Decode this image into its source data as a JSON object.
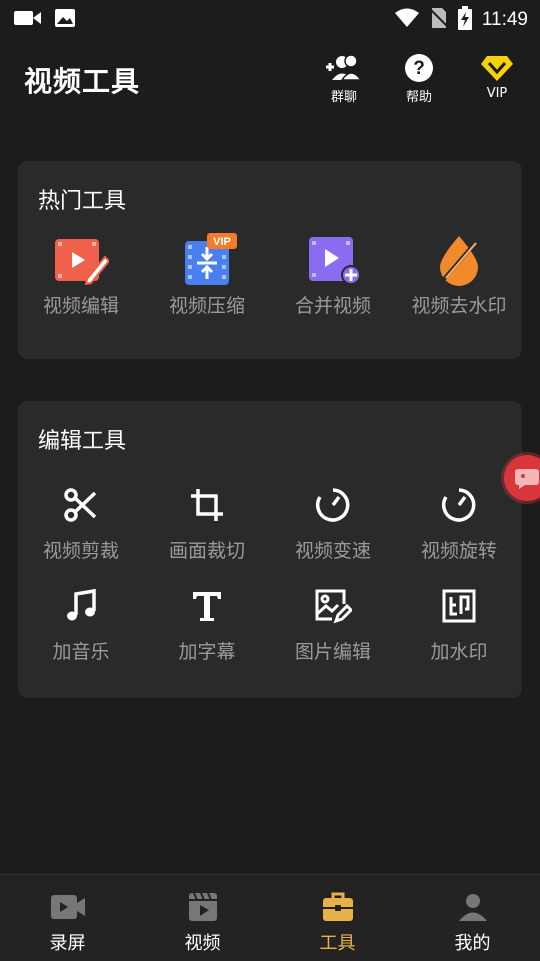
{
  "status_bar": {
    "time": "11:49"
  },
  "header": {
    "title": "视频工具",
    "buttons": [
      {
        "label": "群聊",
        "icon": "add-group-icon"
      },
      {
        "label": "帮助",
        "icon": "help-icon"
      },
      {
        "label": "VIP",
        "icon": "vip-diamond-icon"
      }
    ]
  },
  "hot_tools": {
    "title": "热门工具",
    "items": [
      {
        "label": "视频编辑",
        "icon": "video-edit-icon",
        "color": "#f0604a"
      },
      {
        "label": "视频压缩",
        "icon": "video-compress-icon",
        "color": "#4a7ff0",
        "badge": "VIP"
      },
      {
        "label": "合并视频",
        "icon": "video-merge-icon",
        "color": "#8a6cf0"
      },
      {
        "label": "视频去水印",
        "icon": "remove-watermark-icon",
        "color": "#f08a2a"
      }
    ]
  },
  "edit_tools": {
    "title": "编辑工具",
    "items": [
      {
        "label": "视频剪裁",
        "icon": "scissors-icon"
      },
      {
        "label": "画面裁切",
        "icon": "crop-icon"
      },
      {
        "label": "视频变速",
        "icon": "speed-icon"
      },
      {
        "label": "视频旋转",
        "icon": "rotate-icon"
      },
      {
        "label": "加音乐",
        "icon": "music-note-icon"
      },
      {
        "label": "加字幕",
        "icon": "text-icon"
      },
      {
        "label": "图片编辑",
        "icon": "image-edit-icon"
      },
      {
        "label": "加水印",
        "icon": "watermark-stamp-icon"
      }
    ]
  },
  "bottom_nav": {
    "items": [
      {
        "label": "录屏",
        "icon": "record-screen-icon"
      },
      {
        "label": "视频",
        "icon": "video-clapper-icon"
      },
      {
        "label": "工具",
        "icon": "toolbox-icon",
        "active": true
      },
      {
        "label": "我的",
        "icon": "profile-icon"
      }
    ],
    "active_color": "#e8b24a"
  }
}
